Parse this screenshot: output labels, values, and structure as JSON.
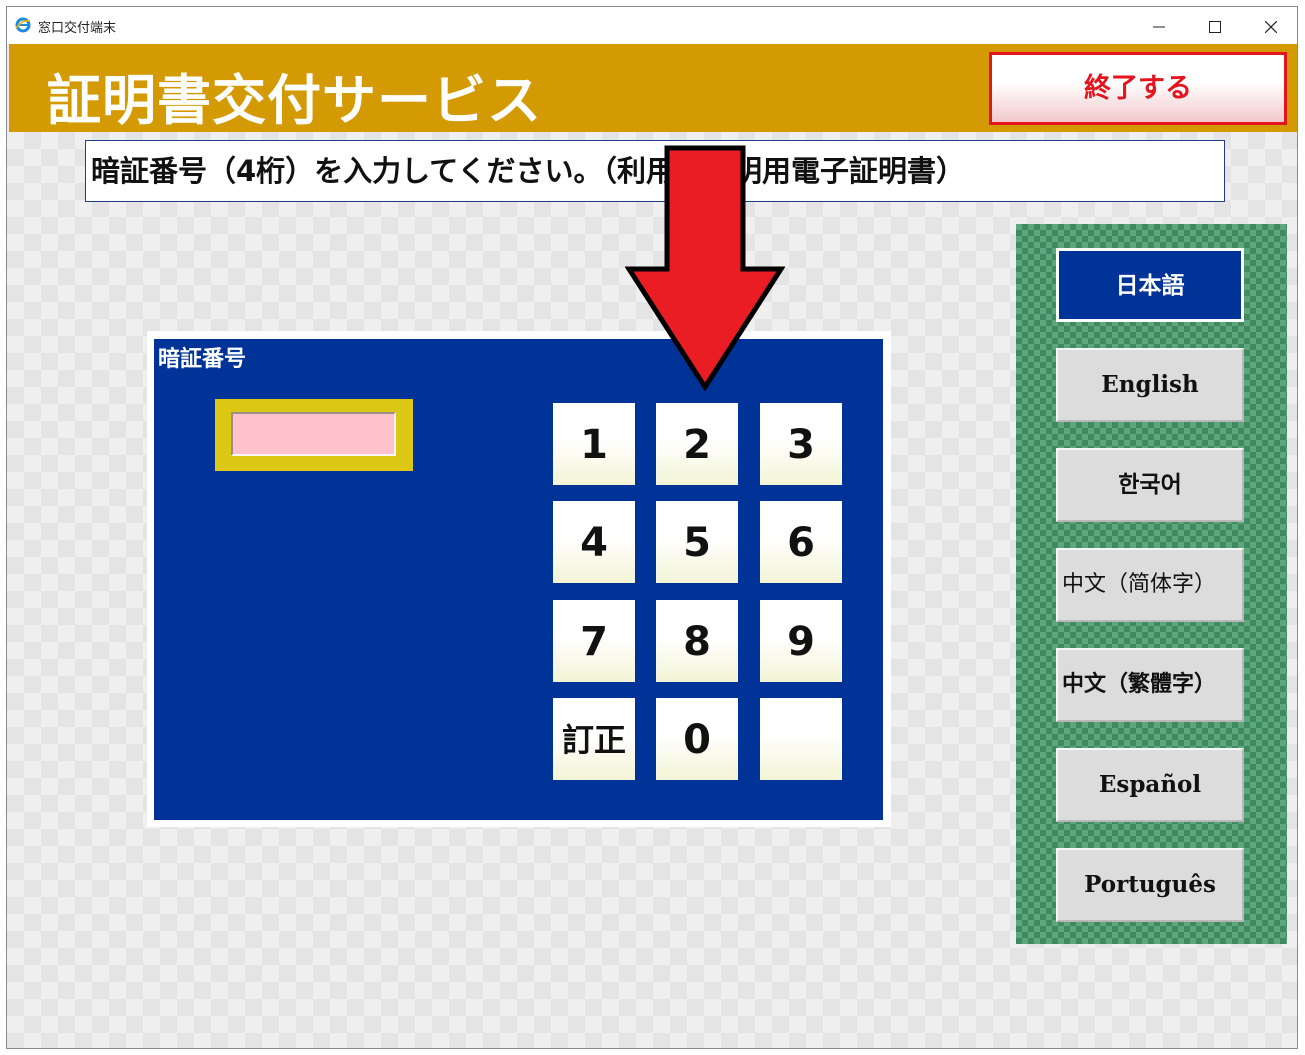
{
  "window": {
    "title": "窓口交付端末"
  },
  "header": {
    "title": "証明書交付サービス",
    "exit_label": "終了する"
  },
  "instruction": {
    "text": "暗証番号（4桁）を入力してください。（利用者証明用電子証明書）"
  },
  "pin_panel": {
    "label": "暗証番号",
    "input_value": "",
    "keys": [
      "1",
      "2",
      "3",
      "4",
      "5",
      "6",
      "7",
      "8",
      "9",
      "訂正",
      "0",
      ""
    ]
  },
  "languages": {
    "items": [
      "日本語",
      "English",
      "한국어",
      "中文（简体字）",
      "中文（繁體字）",
      "Español",
      "Português"
    ],
    "selected": "日本語"
  },
  "colors": {
    "header_bg": "#d49a04",
    "panel_blue": "#003397",
    "exit_red": "#e3141e",
    "pin_frame": "#ddc715",
    "pin_field": "#ffc1cc",
    "lang_panel": "#5ea67d",
    "annotation_arrow": "#ea1c24"
  },
  "icons": [
    "browser-app-icon",
    "minimize-icon",
    "maximize-icon",
    "close-icon",
    "annotation-arrow-down-icon"
  ]
}
